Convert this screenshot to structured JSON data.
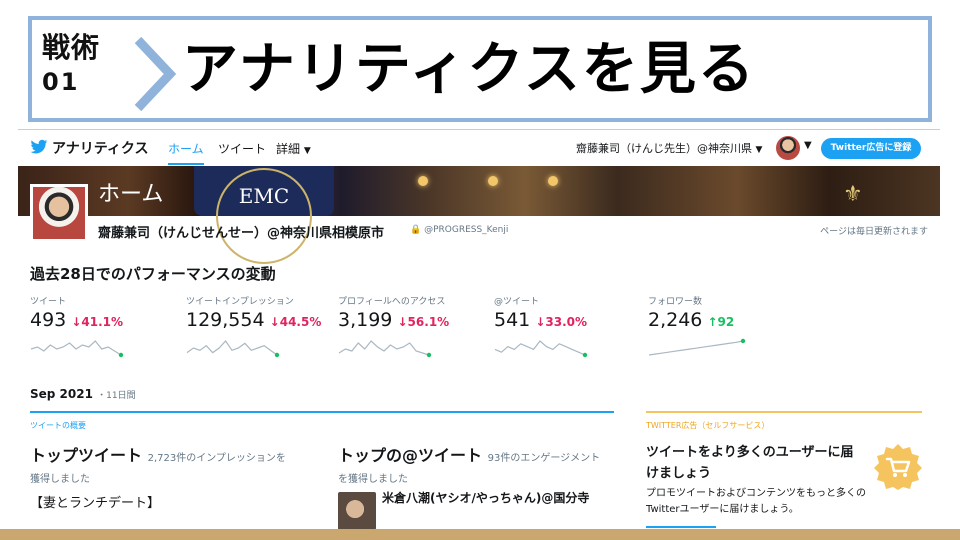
{
  "banner": {
    "lesson_line1": "戦術",
    "lesson_line2": "01",
    "title": "アナリティクスを見る",
    "border_color": "#8fb3db"
  },
  "nav": {
    "app_name": "アナリティクス",
    "tabs": [
      {
        "label": "ホーム",
        "active": true
      },
      {
        "label": "ツイート",
        "active": false
      },
      {
        "label": "詳細",
        "active": false
      }
    ],
    "account": "齋藤兼司（けんじ先生）@神奈川県",
    "cta": "Twitter広告に登録",
    "accent": "#1da1f2"
  },
  "hero": {
    "home_label": "ホーム",
    "emc_text": "EMC"
  },
  "profile": {
    "name": "齋藤兼司（けんじせんせー）@神奈川県相模原市",
    "handle": "@PROGRESS_Kenji",
    "updated_note": "ページは毎日更新されます"
  },
  "summary": {
    "title": "過去28日でのパフォーマンスの変動",
    "metrics": [
      {
        "label": "ツイート",
        "value": "493",
        "change": "↓41.1%",
        "direction": "down",
        "spark": [
          5,
          6,
          4,
          7,
          5,
          6,
          8,
          5,
          7,
          6,
          9,
          5,
          6,
          4,
          2
        ]
      },
      {
        "label": "ツイートインプレッション",
        "value": "129,554",
        "change": "↓44.5%",
        "direction": "down",
        "spark": [
          4,
          6,
          5,
          7,
          4,
          6,
          9,
          5,
          6,
          8,
          5,
          6,
          7,
          5,
          3
        ]
      },
      {
        "label": "プロフィールへのアクセス",
        "value": "3,199",
        "change": "↓56.1%",
        "direction": "down",
        "spark": [
          3,
          5,
          4,
          8,
          5,
          9,
          6,
          4,
          7,
          5,
          6,
          8,
          4,
          3,
          2
        ]
      },
      {
        "label": "@ツイート",
        "value": "541",
        "change": "↓33.0%",
        "direction": "down",
        "spark": [
          5,
          4,
          6,
          5,
          7,
          6,
          5,
          8,
          6,
          5,
          7,
          6,
          5,
          4,
          3
        ]
      },
      {
        "label": "フォロワー数",
        "value": "2,246",
        "change": "↑92",
        "direction": "up",
        "spark": [
          2,
          2.3,
          2.6,
          2.9,
          3.2,
          3.5,
          3.8,
          4.1,
          4.4,
          4.7,
          5,
          5.3,
          5.6,
          5.9,
          6.3
        ]
      }
    ]
  },
  "period": {
    "month": "Sep 2021",
    "separator": "・",
    "days": "11日間"
  },
  "tweet_highlights": {
    "section_label": "ツイートの概要",
    "top_tweet": {
      "title": "トップツイート",
      "note": "2,723件のインプレッションを",
      "cont": "獲得しました",
      "text": "【妻とランチデート】"
    },
    "top_mention": {
      "title": "トップの@ツイート",
      "note": "93件のエンゲージメント",
      "cont": "を獲得しました",
      "user": "米倉八潮(ヤシオ/やっちゃん)@国分寺"
    }
  },
  "ads": {
    "label": "TWITTER広告（セルフサービス）",
    "title": "ツイートをより多くのユーザーに届けましょう",
    "desc": "プロモツイートおよびコンテンツをもっと多くのTwitterユーザーに届けましょう。",
    "accent": "#f5c45e"
  },
  "colors": {
    "down": "#e0245e",
    "up": "#17bf63",
    "footer": "#c9a76f"
  }
}
